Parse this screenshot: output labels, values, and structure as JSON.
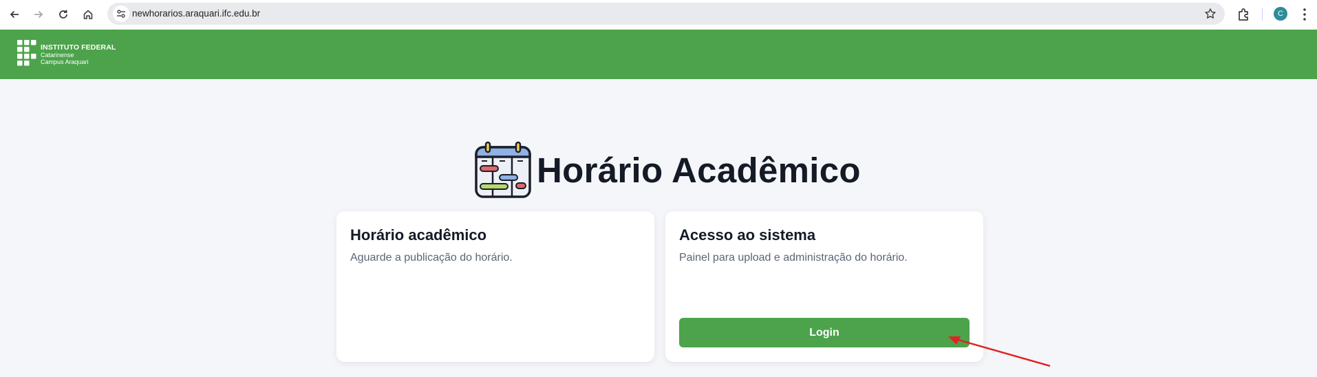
{
  "browser": {
    "url": "newhorarios.araquari.ifc.edu.br",
    "profile_initial": "C",
    "icons": [
      "back-arrow-icon",
      "forward-arrow-icon",
      "reload-icon",
      "home-icon",
      "site-settings-icon",
      "bookmark-star-icon",
      "extensions-icon",
      "menu-dots-icon"
    ]
  },
  "header": {
    "logo_line1": "INSTITUTO FEDERAL",
    "logo_line2": "Catarinense",
    "logo_line3": "Campus Araquari",
    "color": "#4ca34b"
  },
  "main": {
    "title": "Horário Acadêmico",
    "title_icon": "calendar-schedule-icon"
  },
  "cards": {
    "schedule": {
      "title": "Horário acadêmico",
      "description": "Aguarde a publicação do horário."
    },
    "access": {
      "title": "Acesso ao sistema",
      "description": "Painel para upload e administração do horário.",
      "button_label": "Login"
    }
  },
  "annotation": {
    "type": "red-arrow-pointing-to-login",
    "color": "#e02424"
  }
}
